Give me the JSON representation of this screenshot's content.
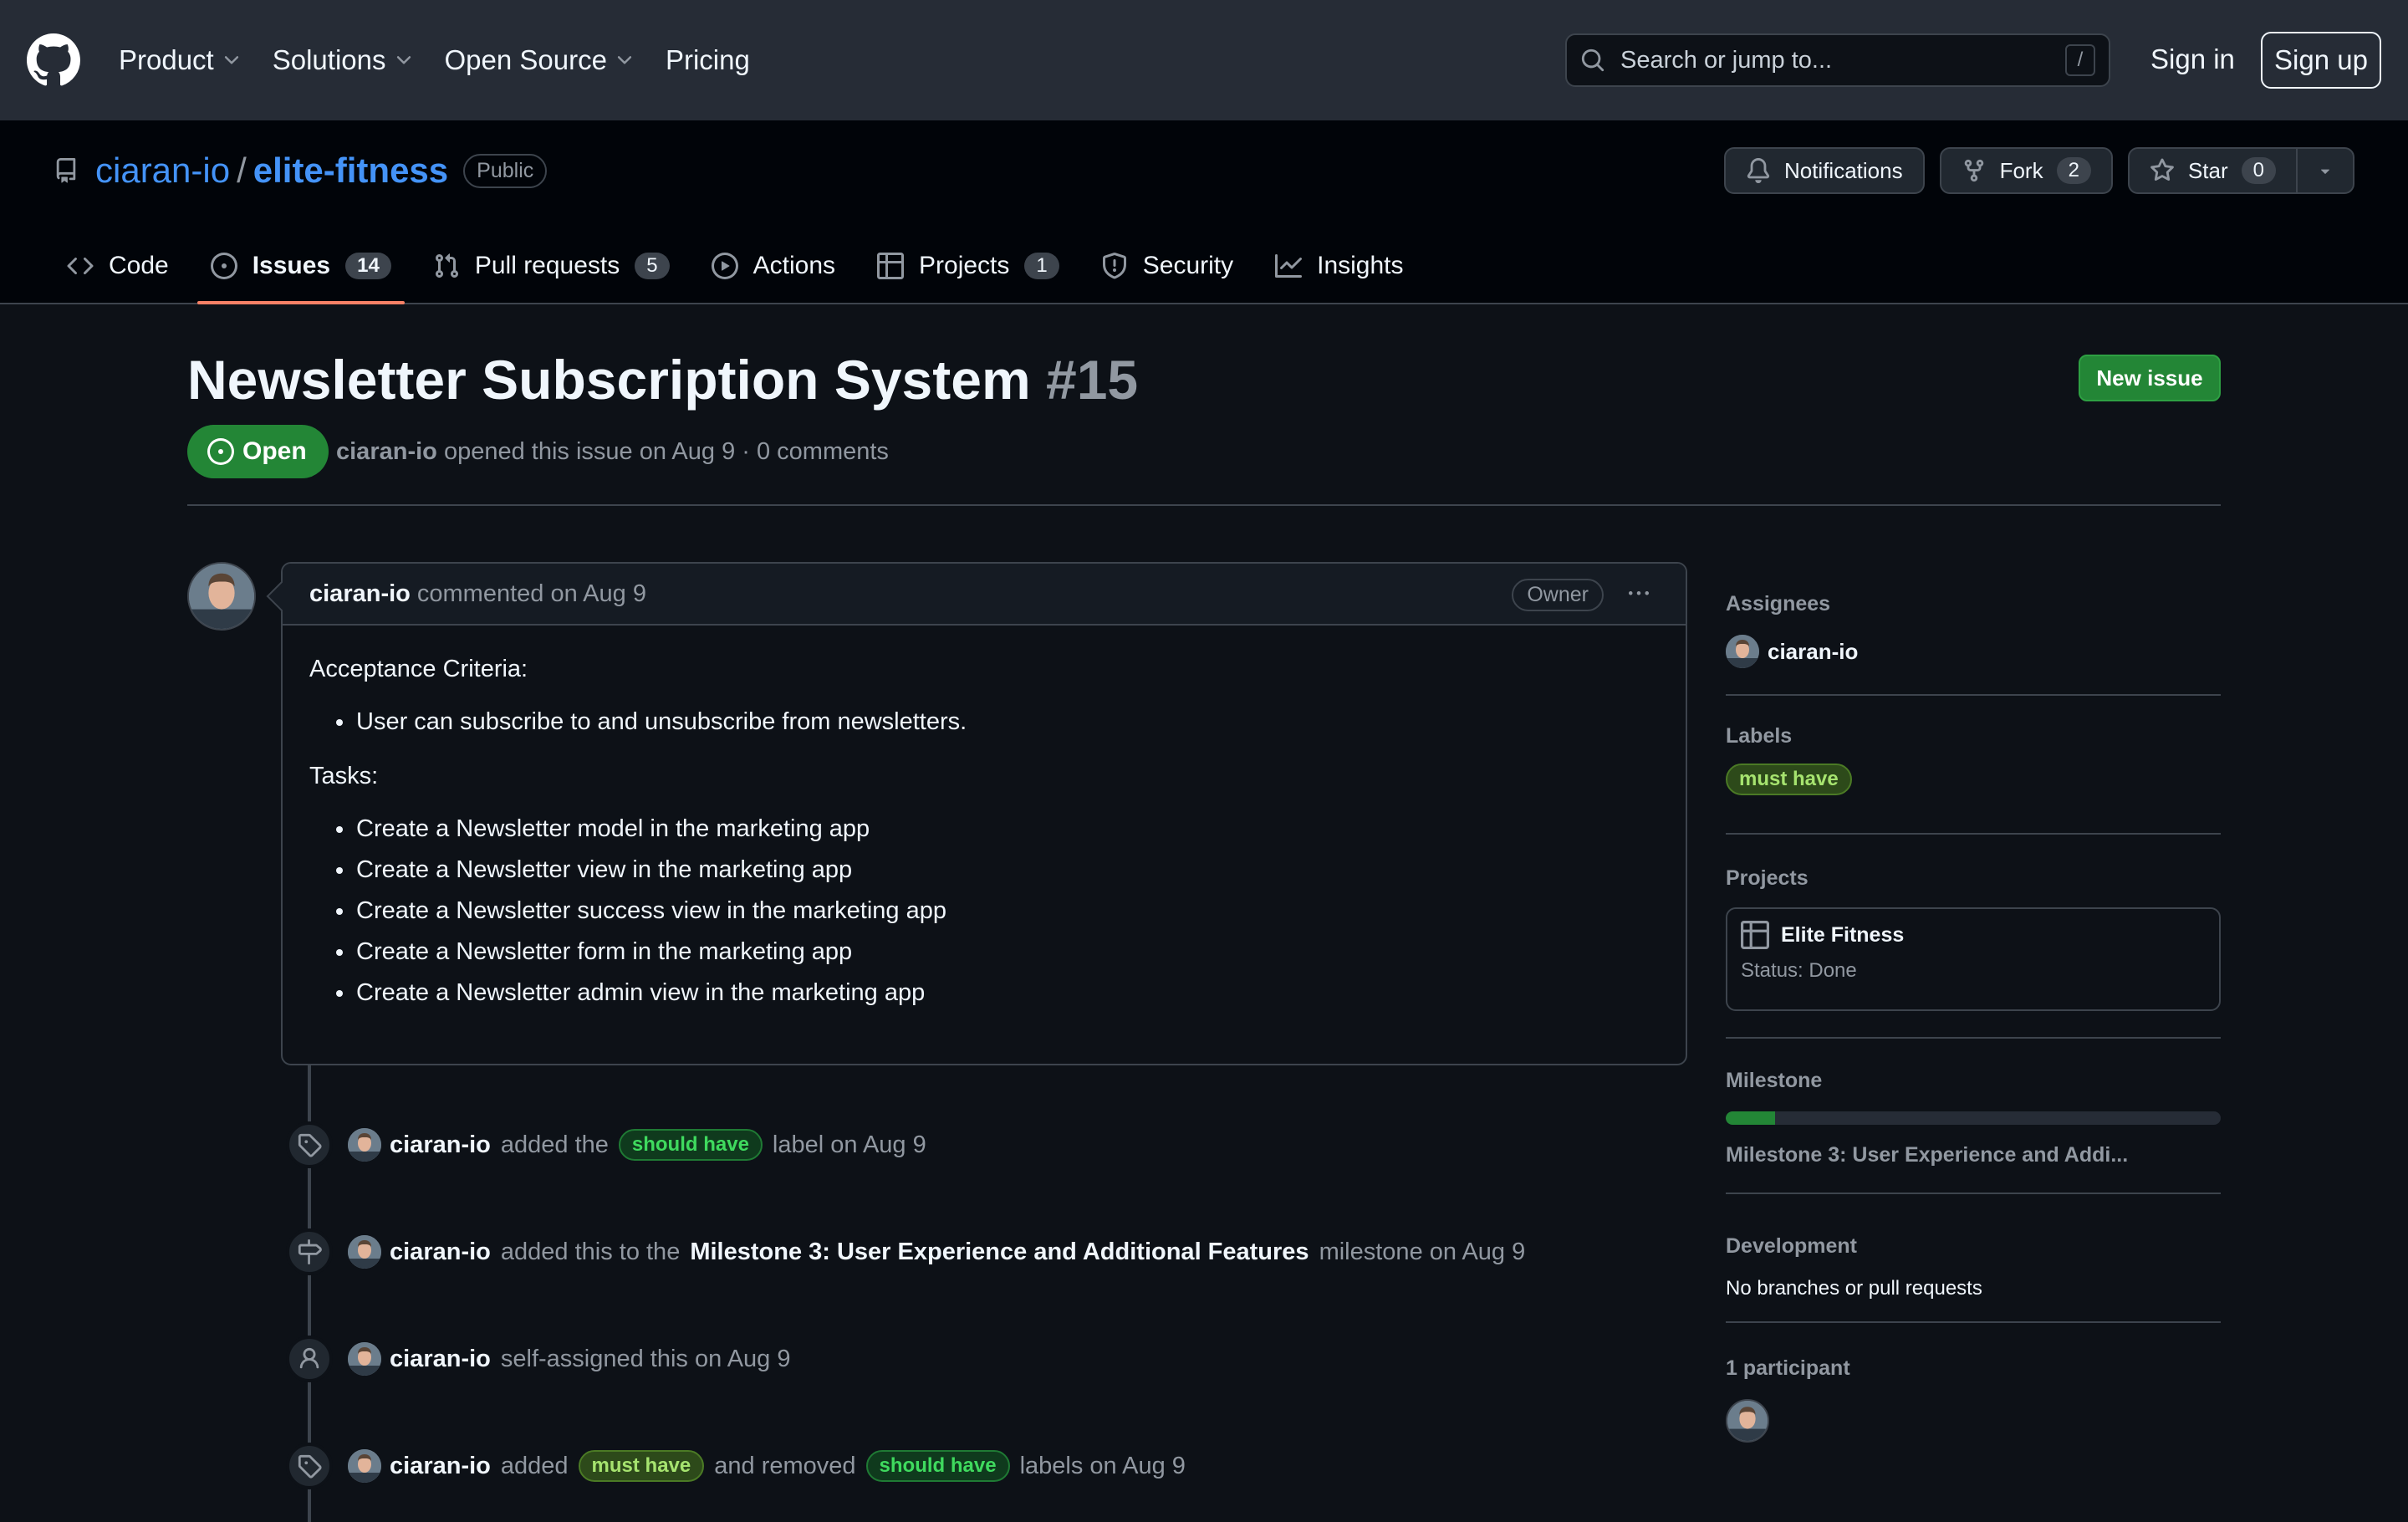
{
  "header": {
    "nav": [
      {
        "label": "Product",
        "dropdown": true
      },
      {
        "label": "Solutions",
        "dropdown": true
      },
      {
        "label": "Open Source",
        "dropdown": true
      },
      {
        "label": "Pricing",
        "dropdown": false
      }
    ],
    "search_placeholder": "Search or jump to...",
    "search_shortcut": "/",
    "sign_in": "Sign in",
    "sign_up": "Sign up"
  },
  "repo": {
    "owner": "ciaran-io",
    "separator": "/",
    "name": "elite-fitness",
    "visibility": "Public",
    "notifications_label": "Notifications",
    "fork_label": "Fork",
    "fork_count": "2",
    "star_label": "Star",
    "star_count": "0",
    "tabs": [
      {
        "label": "Code",
        "count": null,
        "icon": "code-icon"
      },
      {
        "label": "Issues",
        "count": "14",
        "icon": "issue-opened-icon",
        "selected": true
      },
      {
        "label": "Pull requests",
        "count": "5",
        "icon": "git-pull-request-icon"
      },
      {
        "label": "Actions",
        "count": null,
        "icon": "play-icon"
      },
      {
        "label": "Projects",
        "count": "1",
        "icon": "table-icon"
      },
      {
        "label": "Security",
        "count": null,
        "icon": "shield-icon"
      },
      {
        "label": "Insights",
        "count": null,
        "icon": "graph-icon"
      }
    ]
  },
  "issue": {
    "title": "Newsletter Subscription System",
    "number": "#15",
    "new_issue_label": "New issue",
    "state": "Open",
    "author": "ciaran-io",
    "meta_rest": "opened this issue on Aug 9 · 0 comments"
  },
  "comment": {
    "author": "ciaran-io",
    "when": "commented on Aug 9",
    "role": "Owner",
    "criteria_heading": "Acceptance Criteria:",
    "criteria": [
      "User can subscribe to and unsubscribe from newsletters."
    ],
    "tasks_heading": "Tasks:",
    "tasks": [
      "Create a Newsletter model in the marketing app",
      "Create a Newsletter view in the marketing app",
      "Create a Newsletter success view in the marketing app",
      "Create a Newsletter form in the marketing app",
      "Create a Newsletter admin view in the marketing app"
    ]
  },
  "timeline": {
    "e1": {
      "author": "ciaran-io",
      "pre": "added the",
      "label": "should have",
      "post": "label on Aug 9",
      "icon": "tag-icon"
    },
    "e2": {
      "author": "ciaran-io",
      "pre": "added this to the",
      "milestone": "Milestone 3: User Experience and Additional Features",
      "post": "milestone on Aug 9",
      "icon": "milestone-icon"
    },
    "e3": {
      "author": "ciaran-io",
      "text": "self-assigned this on Aug 9",
      "icon": "person-icon"
    },
    "e4": {
      "author": "ciaran-io",
      "pre": "added",
      "added_label": "must have",
      "mid": "and removed",
      "removed_label": "should have",
      "post": "labels on Aug 9",
      "icon": "tag-icon"
    }
  },
  "sidebar": {
    "assignees_heading": "Assignees",
    "assignee": "ciaran-io",
    "labels_heading": "Labels",
    "label": "must have",
    "projects_heading": "Projects",
    "project_name": "Elite Fitness",
    "project_status": "Status: Done",
    "milestone_heading": "Milestone",
    "milestone_name": "Milestone 3: User Experience and Addi...",
    "milestone_progress": 0.1,
    "development_heading": "Development",
    "development_text": "No branches or pull requests",
    "participants_heading": "1 participant"
  },
  "colors": {
    "accent_link": "#4493f8",
    "open_green": "#238636",
    "selected_tab_underline": "#f78166"
  }
}
